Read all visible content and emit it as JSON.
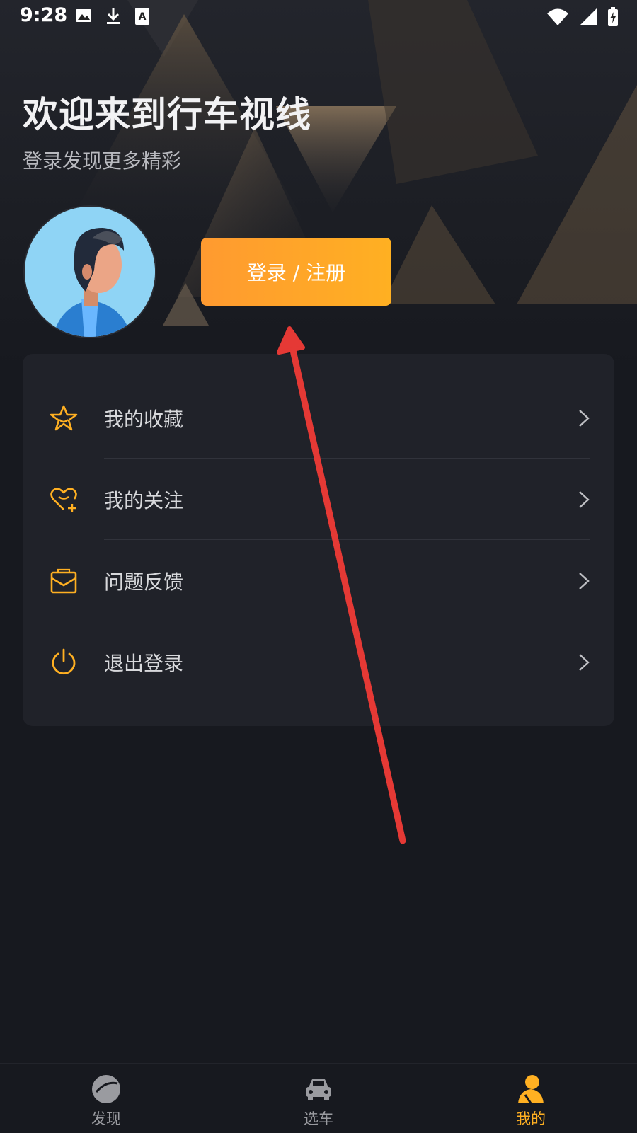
{
  "status_bar": {
    "time": "9:28",
    "left_icons": [
      "image-icon",
      "download-icon",
      "text-a-icon"
    ],
    "right_icons": [
      "wifi-icon",
      "signal-icon",
      "battery-icon"
    ]
  },
  "header": {
    "title": "欢迎来到行车视线",
    "subtitle": "登录发现更多精彩"
  },
  "login_button": {
    "label": "登录 / 注册"
  },
  "menu": {
    "items": [
      {
        "label": "我的收藏",
        "icon": "star-icon"
      },
      {
        "label": "我的关注",
        "icon": "heart-plus-icon"
      },
      {
        "label": "问题反馈",
        "icon": "mail-icon"
      },
      {
        "label": "退出登录",
        "icon": "power-icon"
      }
    ]
  },
  "bottom_nav": {
    "items": [
      {
        "label": "发现",
        "icon": "compass-icon"
      },
      {
        "label": "选车",
        "icon": "car-icon"
      },
      {
        "label": "我的",
        "icon": "person-icon",
        "active": true
      }
    ]
  },
  "colors": {
    "accent": "#ffb022",
    "button_start": "#ff9a30",
    "button_end": "#ffb022",
    "background": "#17191f",
    "card": "#202229",
    "annotation_arrow": "#e53935"
  }
}
